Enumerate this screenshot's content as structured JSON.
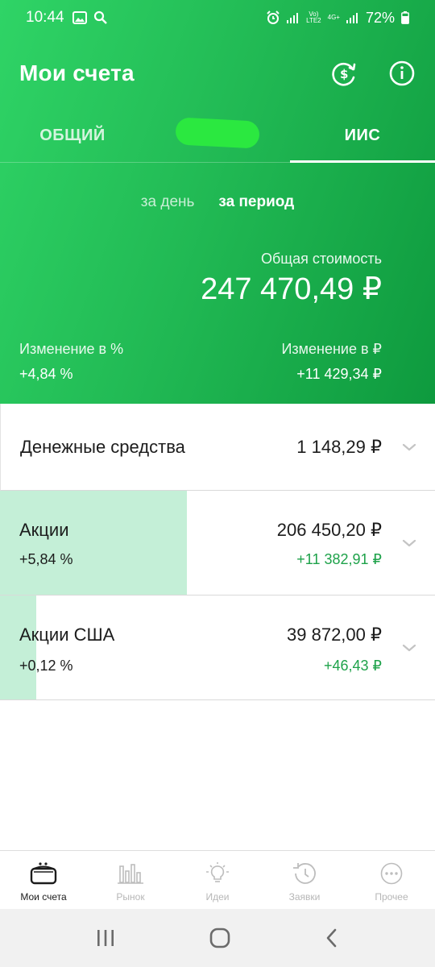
{
  "status_bar": {
    "time": "10:44",
    "network_top": "Vo)",
    "network_bottom": "LTE2",
    "network_type": "4G+",
    "battery": "72%"
  },
  "header": {
    "title": "Мои счета"
  },
  "tabs": [
    {
      "label": "ОБЩИЙ",
      "active": false
    },
    {
      "label": "",
      "active": false
    },
    {
      "label": "ИИС",
      "active": true
    }
  ],
  "period": {
    "day": "за день",
    "range": "за период"
  },
  "summary": {
    "total_label": "Общая стоимость",
    "total_value": "247 470,49 ₽",
    "change_pct_label": "Изменение в  %",
    "change_pct_value": "+4,84  %",
    "change_rub_label": "Изменение в ₽",
    "change_rub_value": "+11 429,34 ₽"
  },
  "rows": [
    {
      "name": "Денежные средства",
      "amount": "1 148,29 ₽",
      "pct": "",
      "delta": "",
      "fill": 0
    },
    {
      "name": "Акции",
      "amount": "206 450,20 ₽",
      "pct": "+5,84  %",
      "delta": "+11 382,91 ₽",
      "fill": 0.43
    },
    {
      "name": "Акции США",
      "amount": "39 872,00 ₽",
      "pct": "+0,12  %",
      "delta": "+46,43 ₽",
      "fill": 0.083
    }
  ],
  "bottom_nav": [
    {
      "label": "Мои счета",
      "icon": "wallet-icon",
      "active": true
    },
    {
      "label": "Рынок",
      "icon": "bar-chart-icon",
      "active": false
    },
    {
      "label": "Идеи",
      "icon": "lightbulb-icon",
      "active": false
    },
    {
      "label": "Заявки",
      "icon": "history-icon",
      "active": false
    },
    {
      "label": "Прочее",
      "icon": "more-icon",
      "active": false
    }
  ],
  "colors": {
    "accent": "#21b04e",
    "positive": "#1ea24a",
    "fill": "#c4efd7"
  }
}
